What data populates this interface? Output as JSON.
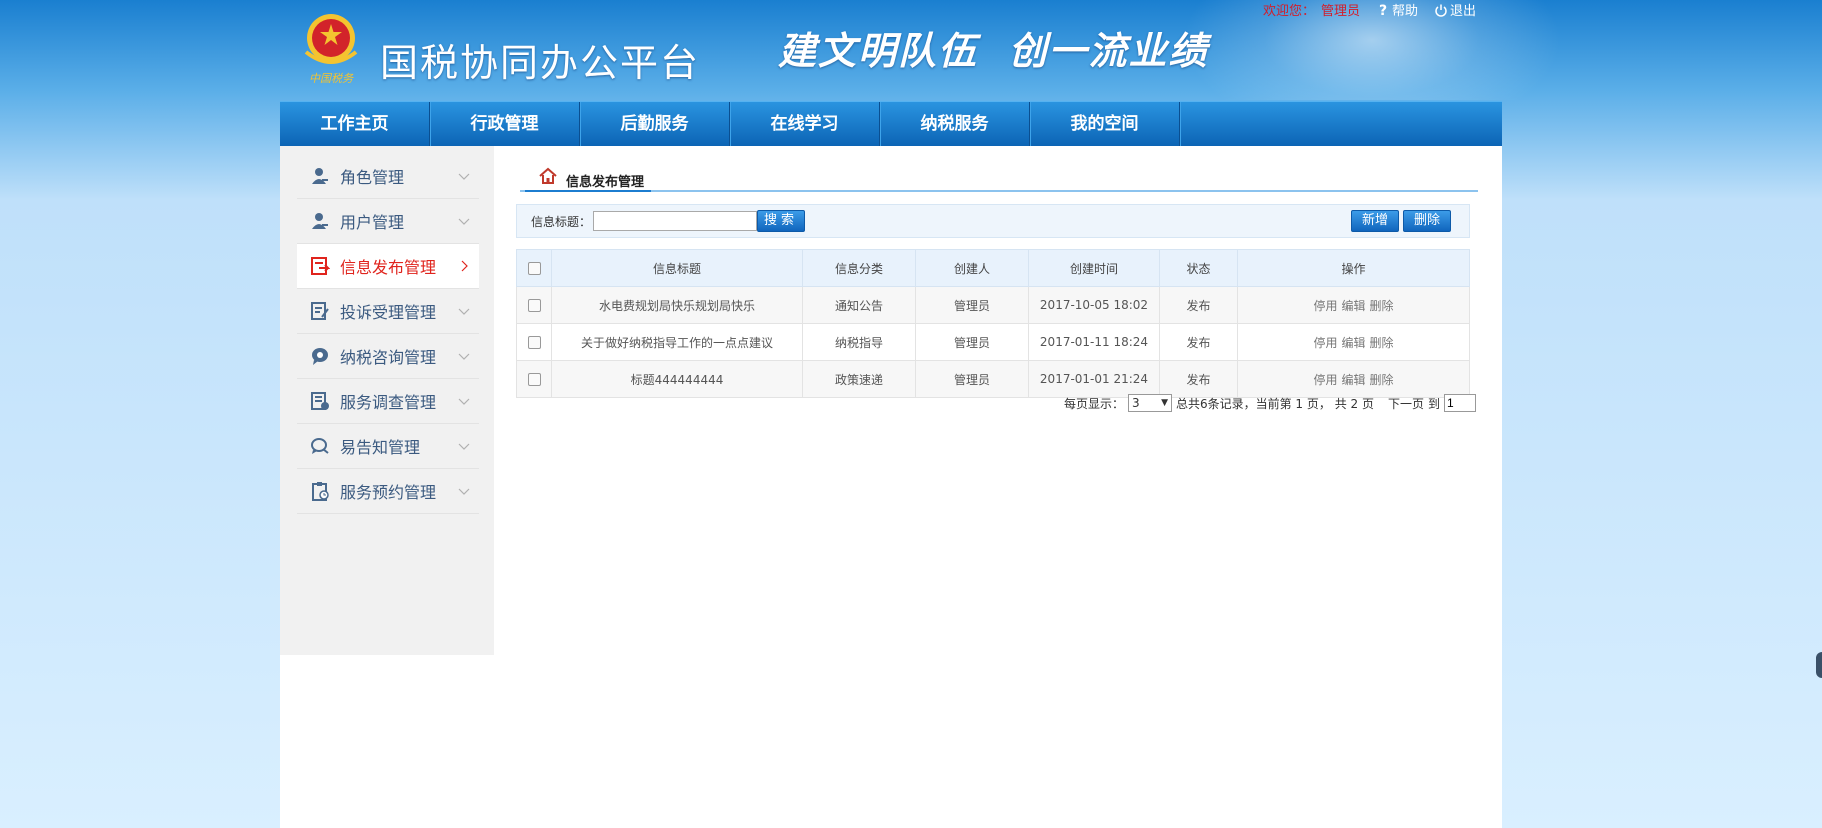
{
  "header": {
    "app_title": "国税协同办公平台",
    "slogan": "建文明队伍  创一流业绩",
    "emblem_text": "中国税务",
    "welcome": "欢迎您：",
    "user": "管理员",
    "help": "帮助",
    "logout": "退出"
  },
  "nav": {
    "items": [
      {
        "label": "工作主页"
      },
      {
        "label": "行政管理"
      },
      {
        "label": "后勤服务"
      },
      {
        "label": "在线学习"
      },
      {
        "label": "纳税服务"
      },
      {
        "label": "我的空间"
      }
    ]
  },
  "sidebar": {
    "items": [
      {
        "label": "角色管理",
        "icon": "user-icon"
      },
      {
        "label": "用户管理",
        "icon": "user-icon"
      },
      {
        "label": "信息发布管理",
        "icon": "publish-icon",
        "active": true
      },
      {
        "label": "投诉受理管理",
        "icon": "complaint-icon"
      },
      {
        "label": "纳税咨询管理",
        "icon": "consult-icon"
      },
      {
        "label": "服务调查管理",
        "icon": "survey-icon"
      },
      {
        "label": "易告知管理",
        "icon": "chat-icon"
      },
      {
        "label": "服务预约管理",
        "icon": "clipboard-icon"
      }
    ]
  },
  "main": {
    "breadcrumb": "信息发布管理",
    "search_label": "信息标题：",
    "search_value": "",
    "search_button": "搜索",
    "add_button": "新增",
    "delete_button": "删除",
    "table": {
      "columns": [
        "信息标题",
        "信息分类",
        "创建人",
        "创建时间",
        "状态",
        "操作"
      ],
      "rows": [
        {
          "title": "水电费规划局快乐规划局快乐",
          "category": "通知公告",
          "creator": "管理员",
          "time": "2017-10-05 18:02",
          "status": "发布",
          "ops": [
            "停用",
            "编辑",
            "删除"
          ]
        },
        {
          "title": "关于做好纳税指导工作的一点点建议",
          "category": "纳税指导",
          "creator": "管理员",
          "time": "2017-01-11 18:24",
          "status": "发布",
          "ops": [
            "停用",
            "编辑",
            "删除"
          ]
        },
        {
          "title": "标题444444444",
          "category": "政策速递",
          "creator": "管理员",
          "time": "2017-01-01 21:24",
          "status": "发布",
          "ops": [
            "停用",
            "编辑",
            "删除"
          ]
        }
      ]
    },
    "pager": {
      "per_page_label": "每页显示：",
      "per_page_value": "3",
      "summary": "总共6条记录，当前第 1 页， 共 2 页",
      "next": "下一页",
      "goto_label": "到",
      "goto_value": "1"
    }
  },
  "colors": {
    "nav_blue": "#0b63b4",
    "accent_red": "#e0241d",
    "sidebar_text": "#3b5a80"
  }
}
